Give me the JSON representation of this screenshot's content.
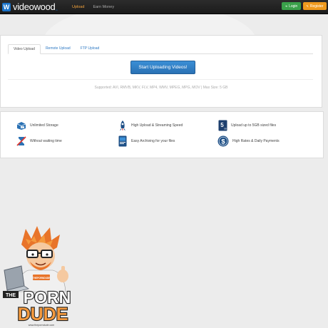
{
  "navbar": {
    "logo_mark": "W",
    "logo_text": "videowood",
    "logo_suffix": "tv",
    "links": [
      {
        "label": "Upload",
        "active": true
      },
      {
        "label": "Earn Money",
        "active": false
      }
    ],
    "login_label": "Login",
    "register_label": "Register"
  },
  "upload": {
    "tabs": [
      {
        "label": "Video Upload",
        "active": true
      },
      {
        "label": "Remote Upload",
        "active": false
      },
      {
        "label": "FTP Upload",
        "active": false
      }
    ],
    "start_button": "Start Uploading Videos!",
    "supported_text": "Supported: AVI, RMVB, MKV, FLV, MP4, WMV, MPEG, MPG, MOV | Max Size: 5 GB"
  },
  "features": [
    {
      "label": "Unlimited Storage",
      "icon": "storage-box-icon"
    },
    {
      "label": "High Upload & Streaming Speed",
      "icon": "speed-rocket-icon"
    },
    {
      "label": "Upload up to 5GB sized files",
      "icon": "5gb-file-icon"
    },
    {
      "label": "Without waiting time",
      "icon": "no-wait-hourglass-icon"
    },
    {
      "label": "Easy Archiving for your files",
      "icon": "archive-book-icon"
    },
    {
      "label": "High Rates & Daily Payments",
      "icon": "dollar-coin-icon"
    }
  ],
  "mascot": {
    "text_the": "THE",
    "text_porn": "PORN",
    "text_dude": "DUDE",
    "badge": "THEPORNDUDE",
    "url": "www.theporndude.com"
  },
  "colors": {
    "accent_blue": "#2a71b4",
    "active_nav": "#f3a33c",
    "login_green": "#3aa14a",
    "register_orange": "#ef9a1e"
  }
}
